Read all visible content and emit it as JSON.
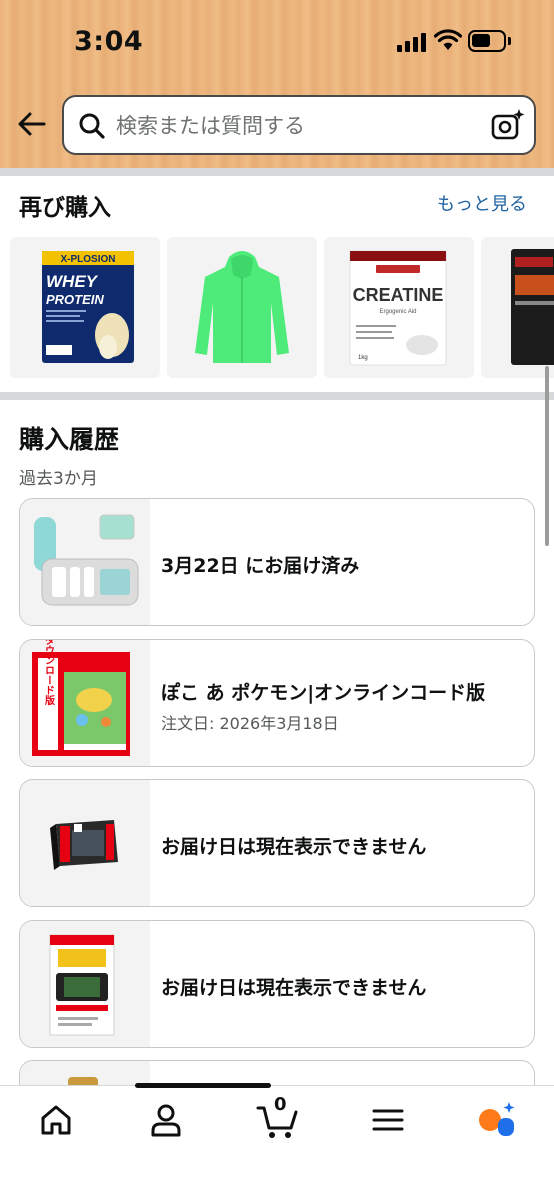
{
  "status_bar": {
    "time": "3:04"
  },
  "search": {
    "placeholder": "検索または質問する"
  },
  "buy_again": {
    "title": "再び購入",
    "see_more": "もっと見る",
    "products": [
      {
        "name": "X-PLOSION WHEY PROTEIN",
        "brand": "X-PLOSION",
        "line1": "WHEY",
        "line2": "PROTEIN"
      },
      {
        "name": "green hoodie"
      },
      {
        "name": "CREATINE",
        "label": "CREATINE",
        "sub": "Ergogenic Aid",
        "weight": "1kg"
      },
      {
        "name": "creatine dark pack"
      }
    ]
  },
  "history": {
    "title": "購入履歴",
    "subtitle": "過去3か月",
    "orders": [
      {
        "status": "3月22日 にお届け済み",
        "date": ""
      },
      {
        "status": "ぽこ あ ポケモン|オンラインコード版",
        "date": "注文日: 2026年3月18日",
        "badge": "ダウンロード版"
      },
      {
        "status": "お届け日は現在表示できません",
        "date": ""
      },
      {
        "status": "お届け日は現在表示できません",
        "date": ""
      }
    ]
  },
  "nav": {
    "cart_count": "0",
    "items": [
      "home-icon",
      "account-icon",
      "cart-icon",
      "menu-icon",
      "rufus-icon"
    ]
  },
  "colors": {
    "link": "#2162a1",
    "header": "#e9b27a",
    "hoodie": "#4eeb7a",
    "accent_orange": "#ff7a1a",
    "accent_blue": "#1f6feb"
  }
}
